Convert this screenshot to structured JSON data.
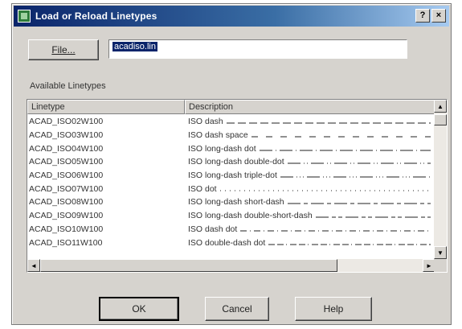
{
  "window": {
    "title": "Load or Reload Linetypes"
  },
  "titlebar": {
    "help_glyph": "?",
    "close_glyph": "×"
  },
  "file": {
    "button_label": "File...",
    "value": "acadiso.lin"
  },
  "list": {
    "label": "Available Linetypes",
    "columns": [
      "Linetype",
      "Description"
    ],
    "rows": [
      {
        "linetype": "ACAD_ISO02W100",
        "description": "ISO dash",
        "pattern": "dash"
      },
      {
        "linetype": "ACAD_ISO03W100",
        "description": "ISO dash space",
        "pattern": "dash-space"
      },
      {
        "linetype": "ACAD_ISO04W100",
        "description": "ISO long-dash dot",
        "pattern": "long-dash-dot"
      },
      {
        "linetype": "ACAD_ISO05W100",
        "description": "ISO long-dash double-dot",
        "pattern": "long-dash-double-dot"
      },
      {
        "linetype": "ACAD_ISO06W100",
        "description": "ISO long-dash triple-dot",
        "pattern": "long-dash-triple-dot"
      },
      {
        "linetype": "ACAD_ISO07W100",
        "description": "ISO dot",
        "pattern": "dot"
      },
      {
        "linetype": "ACAD_ISO08W100",
        "description": "ISO long-dash short-dash",
        "pattern": "long-dash-short-dash"
      },
      {
        "linetype": "ACAD_ISO09W100",
        "description": "ISO long-dash double-short-dash",
        "pattern": "long-dash-double-short-dash"
      },
      {
        "linetype": "ACAD_ISO10W100",
        "description": "ISO dash dot",
        "pattern": "dash-dot"
      },
      {
        "linetype": "ACAD_ISO11W100",
        "description": "ISO double-dash dot",
        "pattern": "double-dash-dot"
      }
    ]
  },
  "buttons": {
    "ok": "OK",
    "cancel": "Cancel",
    "help": "Help"
  },
  "icons": {
    "scroll_up": "▲",
    "scroll_down": "▼",
    "scroll_left": "◄",
    "scroll_right": "►"
  }
}
